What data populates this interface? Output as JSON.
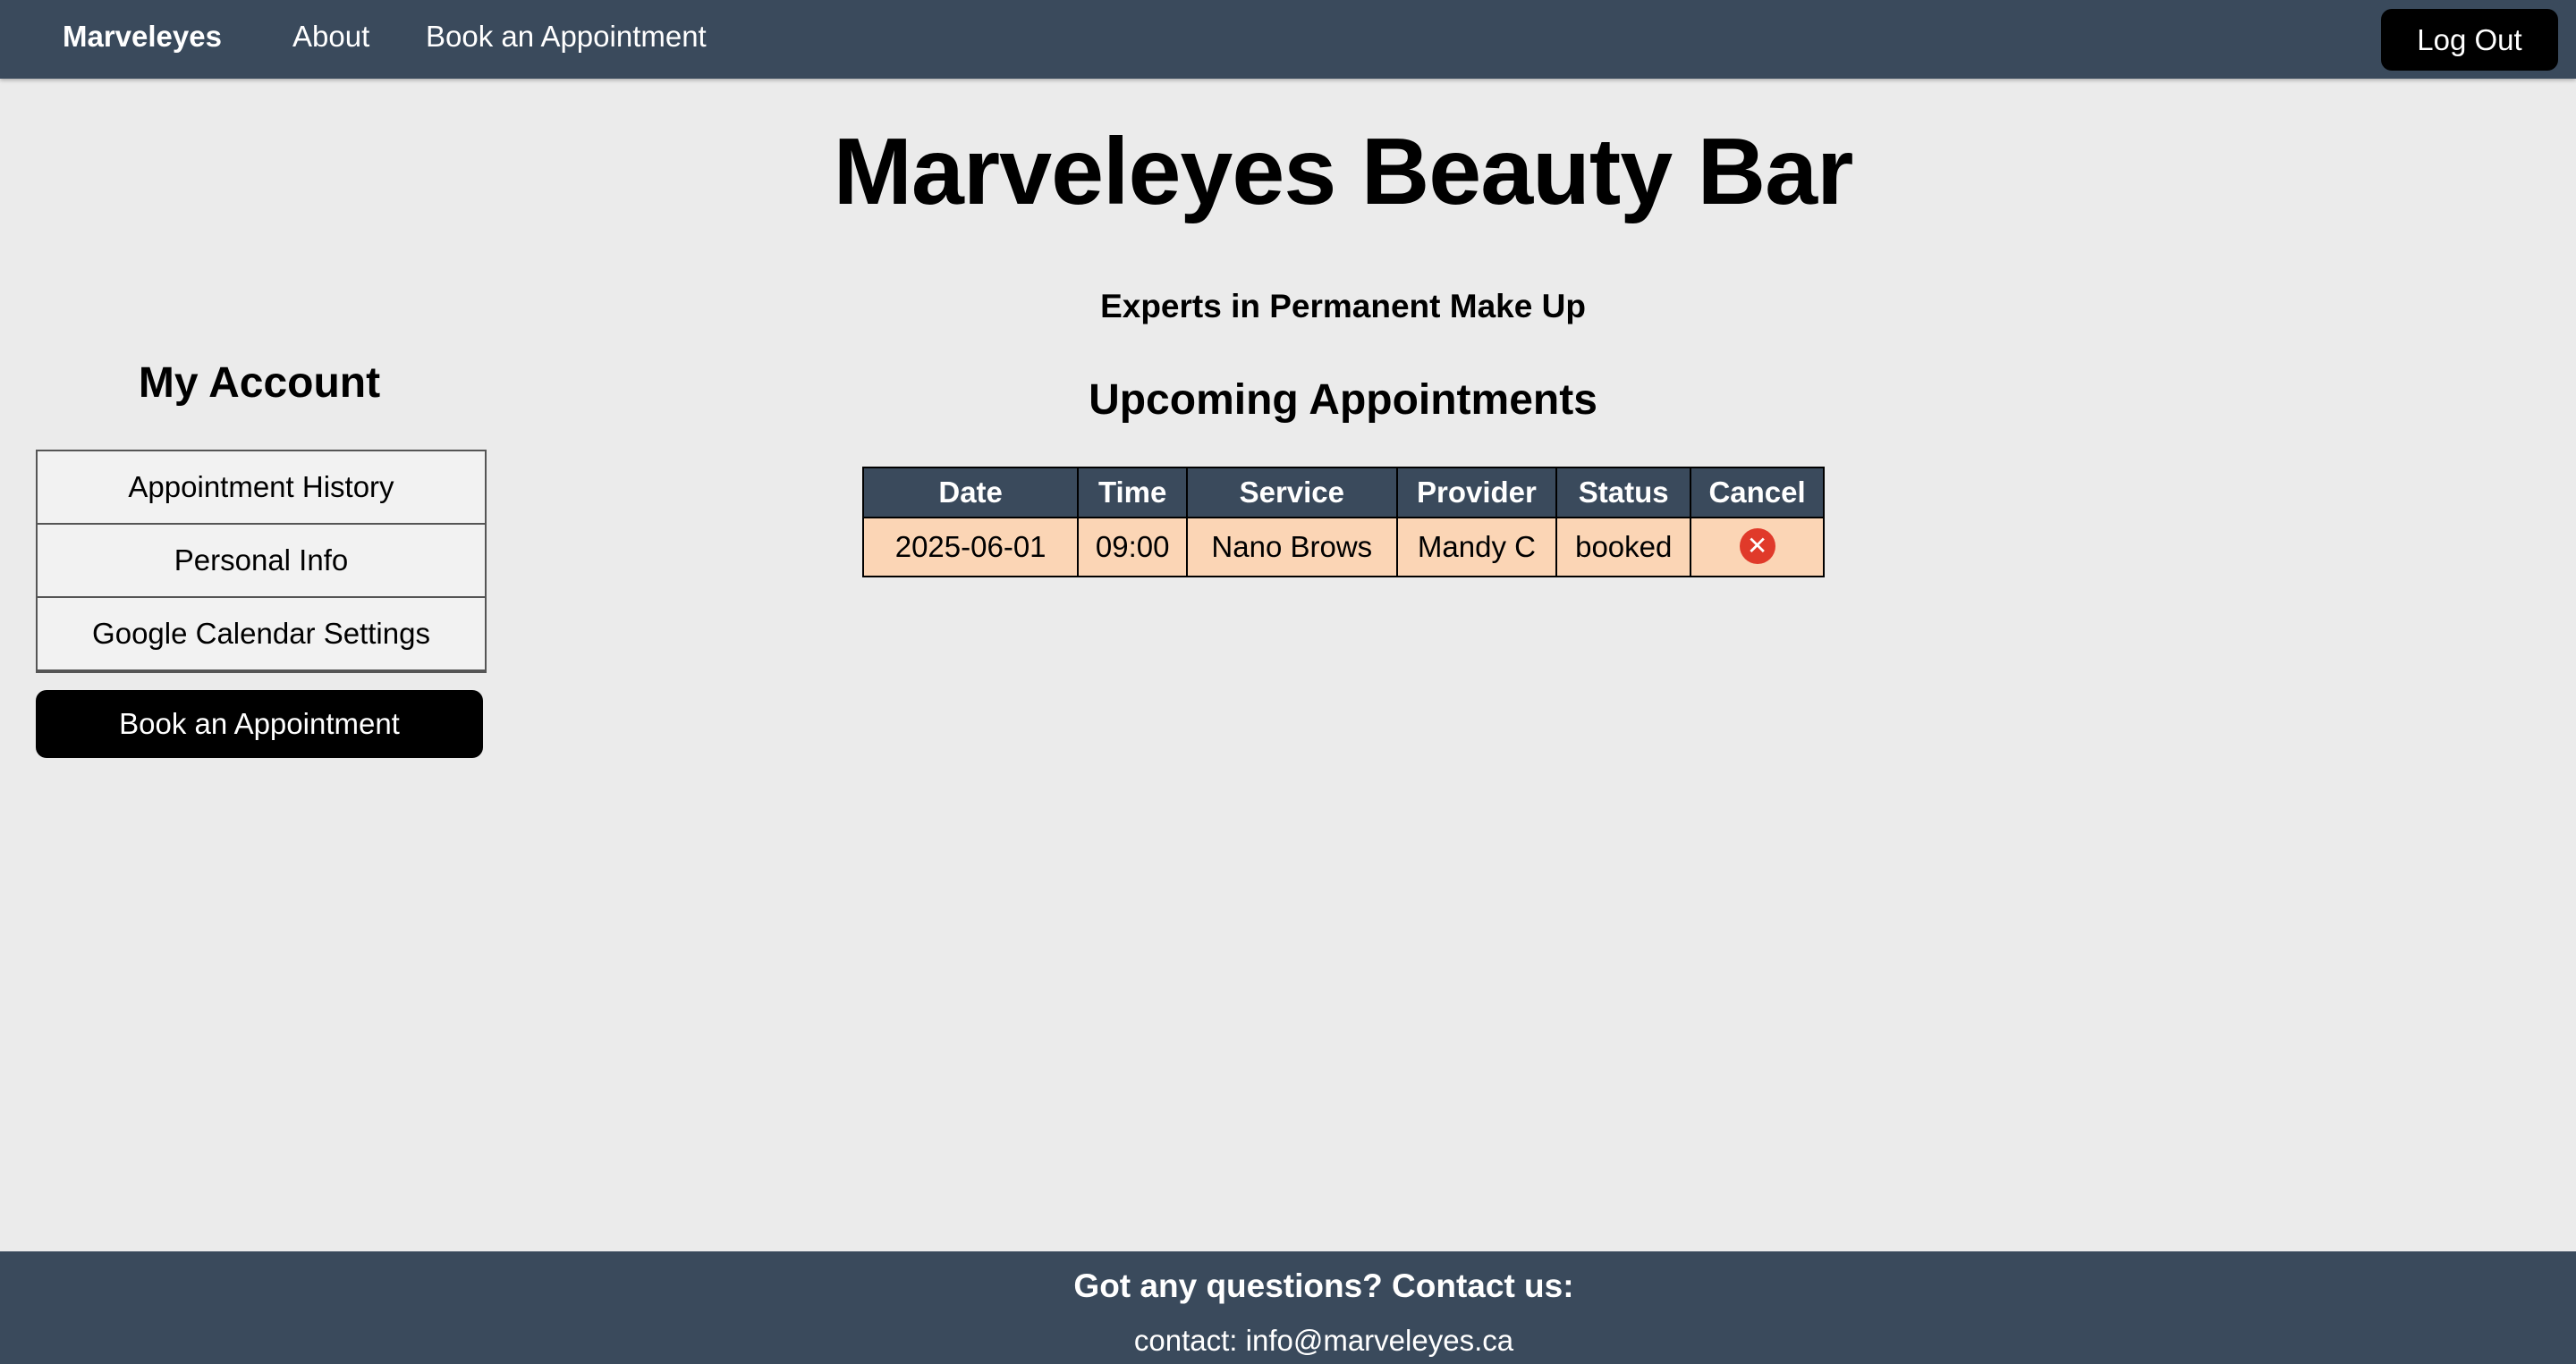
{
  "navbar": {
    "brand": "Marveleyes",
    "links": [
      "About",
      "Book an Appointment"
    ],
    "logout_label": "Log Out"
  },
  "hero": {
    "title": "Marveleyes Beauty Bar",
    "tagline": "Experts in Permanent Make Up"
  },
  "sidebar": {
    "title": "My Account",
    "items": [
      "Appointment History",
      "Personal Info",
      "Google Calendar Settings"
    ],
    "book_label": "Book an Appointment"
  },
  "appointments": {
    "title": "Upcoming Appointments",
    "columns": [
      "Date",
      "Time",
      "Service",
      "Provider",
      "Status",
      "Cancel"
    ],
    "rows": [
      {
        "date": "2025-06-01",
        "time": "09:00",
        "service": "Nano Brows",
        "provider": "Mandy C",
        "status": "booked",
        "cancel_icon": "close-circle-icon"
      }
    ]
  },
  "footer": {
    "title": "Got any questions? Contact us:",
    "contact": "contact: info@marveleyes.ca"
  },
  "colors": {
    "nav_bg": "#3a4a5c",
    "page_bg": "#ebebeb",
    "row_bg": "#fbd5b5",
    "cancel_red": "#e03a2a",
    "button_black": "#000000"
  }
}
